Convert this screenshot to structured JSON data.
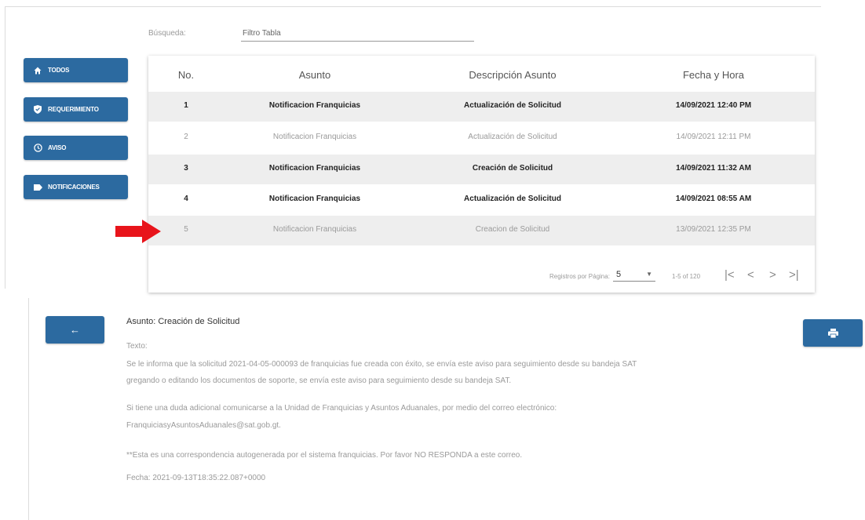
{
  "search": {
    "label": "Búsqueda:",
    "filter_placeholder": "Filtro Tabla"
  },
  "sidebar": {
    "items": [
      {
        "label": "TODOS",
        "icon": "home-icon"
      },
      {
        "label": "REQUERIMIENTO",
        "icon": "shield-icon"
      },
      {
        "label": "AVISO",
        "icon": "clock-icon"
      },
      {
        "label": "NOTIFICACIONES",
        "icon": "tag-icon"
      }
    ]
  },
  "table": {
    "headers": [
      "No.",
      "Asunto",
      "Descripción Asunto",
      "Fecha y Hora"
    ],
    "rows": [
      {
        "no": "1",
        "asunto": "Notificacion Franquicias",
        "descripcion": "Actualización de Solicitud",
        "fecha": "14/09/2021 12:40 PM"
      },
      {
        "no": "2",
        "asunto": "Notificacion Franquicias",
        "descripcion": "Actualización de Solicitud",
        "fecha": "14/09/2021 12:11 PM"
      },
      {
        "no": "3",
        "asunto": "Notificacion Franquicias",
        "descripcion": "Creación de Solicitud",
        "fecha": "14/09/2021 11:32 AM"
      },
      {
        "no": "4",
        "asunto": "Notificacion Franquicias",
        "descripcion": "Actualización de Solicitud",
        "fecha": "14/09/2021 08:55 AM"
      },
      {
        "no": "5",
        "asunto": "Notificacion Franquicias",
        "descripcion": "Creacion de Solicitud",
        "fecha": "13/09/2021 12:35 PM"
      }
    ]
  },
  "pagination": {
    "rows_per_page_label": "Registros por Página:",
    "rows_per_page_value": "5",
    "range_text": "1-5 of 120",
    "first": "|<",
    "prev": "<",
    "next": ">",
    "last": ">|"
  },
  "detail": {
    "back_label": "←",
    "subject": "Asunto: Creación de Solicitud",
    "text_label": "Texto:",
    "paragraph1": "Se le informa que la solicitud 2021-04-05-000093 de franquicias fue creada con éxito, se envía este aviso para seguimiento desde su bandeja SAT",
    "paragraph1b": "gregando o editando los documentos de soporte, se envía este aviso para seguimiento desde su bandeja SAT.",
    "paragraph2": "Si tiene una duda adicional comunicarse a la Unidad de Franquicias y Asuntos Aduanales, por medio del correo electrónico:",
    "paragraph2b": "FranquiciasyAsuntosAduanales@sat.gob.gt.",
    "paragraph3": "**Esta es una correspondencia autogenerada por el sistema franquicias. Por favor NO RESPONDA a este correo.",
    "fecha": "Fecha: 2021-09-13T18:35:22.087+0000"
  },
  "colors": {
    "primary": "#2c6aa0",
    "arrow": "#e8141b",
    "row_shade": "#eeeeee"
  }
}
